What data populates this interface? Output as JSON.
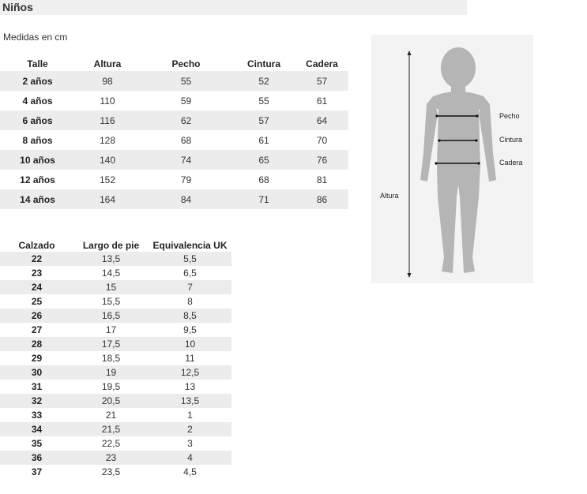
{
  "header": {
    "title": "Niños"
  },
  "subtitle": "Medidas en cm",
  "size_table": {
    "headers": [
      "Talle",
      "Altura",
      "Pecho",
      "Cintura",
      "Cadera"
    ],
    "rows": [
      [
        "2 años",
        "98",
        "55",
        "52",
        "57"
      ],
      [
        "4 años",
        "110",
        "59",
        "55",
        "61"
      ],
      [
        "6 años",
        "116",
        "62",
        "57",
        "64"
      ],
      [
        "8 años",
        "128",
        "68",
        "61",
        "70"
      ],
      [
        "10 años",
        "140",
        "74",
        "65",
        "76"
      ],
      [
        "12 años",
        "152",
        "79",
        "68",
        "81"
      ],
      [
        "14 años",
        "164",
        "84",
        "71",
        "86"
      ]
    ]
  },
  "shoe_table": {
    "headers": [
      "Calzado",
      "Largo de pie",
      "Equivalencia UK"
    ],
    "rows": [
      [
        "22",
        "13,5",
        "5,5"
      ],
      [
        "23",
        "14,5",
        "6,5"
      ],
      [
        "24",
        "15",
        "7"
      ],
      [
        "25",
        "15,5",
        "8"
      ],
      [
        "26",
        "16,5",
        "8,5"
      ],
      [
        "27",
        "17",
        "9,5"
      ],
      [
        "28",
        "17,5",
        "10"
      ],
      [
        "29",
        "18,5",
        "11"
      ],
      [
        "30",
        "19",
        "12,5"
      ],
      [
        "31",
        "19,5",
        "13"
      ],
      [
        "32",
        "20,5",
        "13,5"
      ],
      [
        "33",
        "21",
        "1"
      ],
      [
        "34",
        "21,5",
        "2"
      ],
      [
        "35",
        "22,5",
        "3"
      ],
      [
        "36",
        "23",
        "4"
      ],
      [
        "37",
        "23,5",
        "4,5"
      ]
    ]
  },
  "figure": {
    "labels": {
      "chest": "Pecho",
      "waist": "Cintura",
      "hip": "Cadera",
      "height": "Altura"
    }
  }
}
